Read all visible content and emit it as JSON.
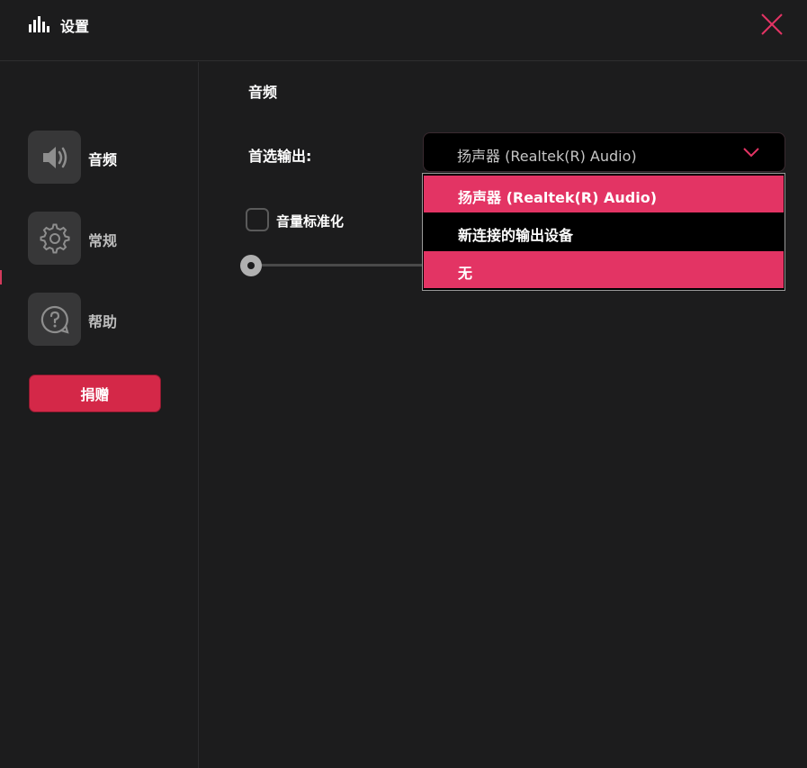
{
  "window": {
    "title": "设置",
    "accent_color": "#e33464"
  },
  "sidebar": {
    "items": [
      {
        "label": "音频",
        "icon": "speaker-icon",
        "active": true
      },
      {
        "label": "常规",
        "icon": "gear-icon",
        "active": false
      },
      {
        "label": "帮助",
        "icon": "help-icon",
        "active": false
      }
    ],
    "donate_label": "捐赠"
  },
  "main": {
    "section_title": "音频",
    "output_label": "首选输出:",
    "output_select": {
      "value": "扬声器 (Realtek(R) Audio)",
      "options": [
        {
          "label": "扬声器 (Realtek(R) Audio)",
          "highlighted": true
        },
        {
          "label": "新连接的输出设备",
          "highlighted": false
        },
        {
          "label": "无",
          "highlighted": true
        }
      ]
    },
    "normalize_label": "音量标准化",
    "normalize_checked": false,
    "volume_level": 0
  }
}
